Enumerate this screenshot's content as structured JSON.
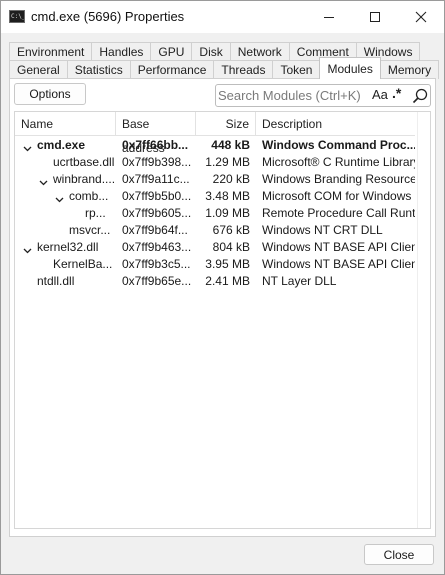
{
  "window": {
    "title": "cmd.exe (5696) Properties",
    "icon": "cmd-icon",
    "icon_text": "C:\\_"
  },
  "tabs_row1": [
    "Environment",
    "Handles",
    "GPU",
    "Disk",
    "Network",
    "Comment",
    "Windows"
  ],
  "tabs_row2": [
    "General",
    "Statistics",
    "Performance",
    "Threads",
    "Token",
    "Modules",
    "Memory"
  ],
  "active_tab": "Modules",
  "toolbar": {
    "options_label": "Options",
    "search_placeholder": "Search Modules (Ctrl+K)",
    "case_toggle": "Aa",
    "regex_toggle": ".*"
  },
  "columns": [
    "Name",
    "Base address",
    "Size",
    "Description"
  ],
  "modules": [
    {
      "name": "cmd.exe",
      "base": "0x7ff66bb...",
      "size": "448 kB",
      "desc": "Windows Command Proc...",
      "level": 0,
      "expanded": true,
      "bold": true
    },
    {
      "name": "ucrtbase.dll",
      "base": "0x7ff9b398...",
      "size": "1.29 MB",
      "desc": "Microsoft® C Runtime Library",
      "level": 1,
      "expanded": null,
      "bold": false
    },
    {
      "name": "winbrand....",
      "base": "0x7ff9a11c...",
      "size": "220 kB",
      "desc": "Windows Branding Resources",
      "level": 1,
      "expanded": true,
      "bold": false
    },
    {
      "name": "comb...",
      "base": "0x7ff9b5b0...",
      "size": "3.48 MB",
      "desc": "Microsoft COM for Windows",
      "level": 2,
      "expanded": true,
      "bold": false
    },
    {
      "name": "rp...",
      "base": "0x7ff9b605...",
      "size": "1.09 MB",
      "desc": "Remote Procedure Call Runt...",
      "level": 3,
      "expanded": null,
      "bold": false
    },
    {
      "name": "msvcr...",
      "base": "0x7ff9b64f...",
      "size": "676 kB",
      "desc": "Windows NT CRT DLL",
      "level": 2,
      "expanded": null,
      "bold": false
    },
    {
      "name": "kernel32.dll",
      "base": "0x7ff9b463...",
      "size": "804 kB",
      "desc": "Windows NT BASE API Clien...",
      "level": 0,
      "expanded": true,
      "bold": false
    },
    {
      "name": "KernelBa...",
      "base": "0x7ff9b3c5...",
      "size": "3.95 MB",
      "desc": "Windows NT BASE API Clien...",
      "level": 1,
      "expanded": null,
      "bold": false
    },
    {
      "name": "ntdll.dll",
      "base": "0x7ff9b65e...",
      "size": "2.41 MB",
      "desc": "NT Layer DLL",
      "level": 0,
      "expanded": null,
      "bold": false
    }
  ],
  "footer": {
    "close_label": "Close"
  }
}
